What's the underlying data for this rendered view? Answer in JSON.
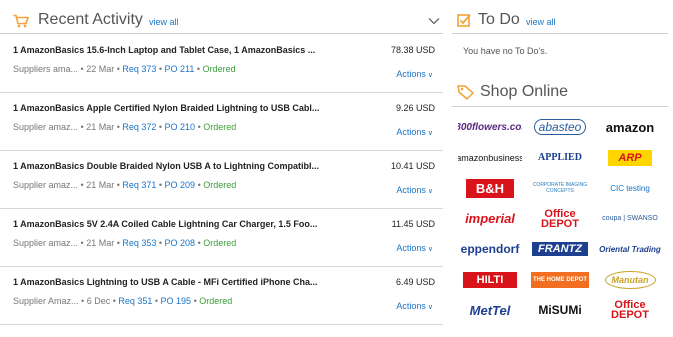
{
  "recent_activity": {
    "title": "Recent Activity",
    "view_all": "view all",
    "rows": [
      {
        "title": "1 AmazonBasics 15.6-Inch Laptop and Tablet Case, 1 AmazonBasics ...",
        "price": "78.38 USD",
        "supplier": "Suppliers ama...",
        "date": "22 Mar",
        "req": "Req 373",
        "po": "PO 211",
        "status": "Ordered",
        "actions": "Actions"
      },
      {
        "title": "1 AmazonBasics Apple Certified Nylon Braided Lightning to USB Cabl...",
        "price": "9.26 USD",
        "supplier": "Supplier amaz...",
        "date": "21 Mar",
        "req": "Req 372",
        "po": "PO 210",
        "status": "Ordered",
        "actions": "Actions"
      },
      {
        "title": "1 AmazonBasics Double Braided Nylon USB A to Lightning Compatibl...",
        "price": "10.41 USD",
        "supplier": "Supplier amaz...",
        "date": "21 Mar",
        "req": "Req 371",
        "po": "PO 209",
        "status": "Ordered",
        "actions": "Actions"
      },
      {
        "title": "1 AmazonBasics 5V 2.4A Coiled Cable Lightning Car Charger, 1.5 Foo...",
        "price": "11.45 USD",
        "supplier": "Supplier amaz...",
        "date": "21 Mar",
        "req": "Req 353",
        "po": "PO 208",
        "status": "Ordered",
        "actions": "Actions"
      },
      {
        "title": "1 AmazonBasics Lightning to USB A Cable - MFi Certified iPhone Cha...",
        "price": "6.49 USD",
        "supplier": "Supplier Amaz...",
        "date": "6 Dec",
        "req": "Req 351",
        "po": "PO 195",
        "status": "Ordered",
        "actions": "Actions"
      }
    ]
  },
  "todo": {
    "title": "To Do",
    "view_all": "view all",
    "empty_message": "You have no To Do's."
  },
  "shop_online": {
    "title": "Shop Online",
    "suppliers": [
      {
        "name": "1-800-flowers",
        "label": "1800flowers.com",
        "color": "#5a2a82"
      },
      {
        "name": "abasteo",
        "label": "abasteo",
        "color": "#2a5d9c"
      },
      {
        "name": "amazon",
        "label": "amazon",
        "color": "#111111"
      },
      {
        "name": "amazon-business",
        "label": "amazonbusiness",
        "color": "#111111"
      },
      {
        "name": "applied",
        "label": "APPLIED",
        "color": "#1d3f8f"
      },
      {
        "name": "arp",
        "label": "ARP",
        "color": "#d8141a"
      },
      {
        "name": "b-and-h",
        "label": "B&H",
        "color": "#d8141a"
      },
      {
        "name": "corporate-imaging-concepts",
        "label": "CORPORATE IMAGING CONCEPTS",
        "color": "#2a7fc1"
      },
      {
        "name": "cic-testing",
        "label": "CIC testing",
        "color": "#1a75c7"
      },
      {
        "name": "imperial",
        "label": "imperial",
        "color": "#d8141a"
      },
      {
        "name": "office-depot",
        "label": "Office DEPOT",
        "color": "#d8141a"
      },
      {
        "name": "coupa-swanson",
        "label": "coupa | SWANSO",
        "color": "#2a5d9c"
      },
      {
        "name": "eppendorf",
        "label": "eppendorf",
        "color": "#1d3f8f"
      },
      {
        "name": "frantz",
        "label": "FRANTZ",
        "color": "#1d3f8f"
      },
      {
        "name": "oriental-trading",
        "label": "Oriental Trading",
        "color": "#1d3f8f"
      },
      {
        "name": "hilti",
        "label": "HILTI",
        "color": "#d8141a"
      },
      {
        "name": "home-depot",
        "label": "THE HOME DEPOT",
        "color": "#f26f21"
      },
      {
        "name": "manutan",
        "label": "Manutan",
        "color": "#c9a227"
      },
      {
        "name": "mettel",
        "label": "MetTel",
        "color": "#1d3f8f"
      },
      {
        "name": "misumi",
        "label": "MiSUMi",
        "color": "#111111"
      },
      {
        "name": "office-depot-2",
        "label": "Office DEPOT",
        "color": "#d8141a"
      }
    ]
  }
}
